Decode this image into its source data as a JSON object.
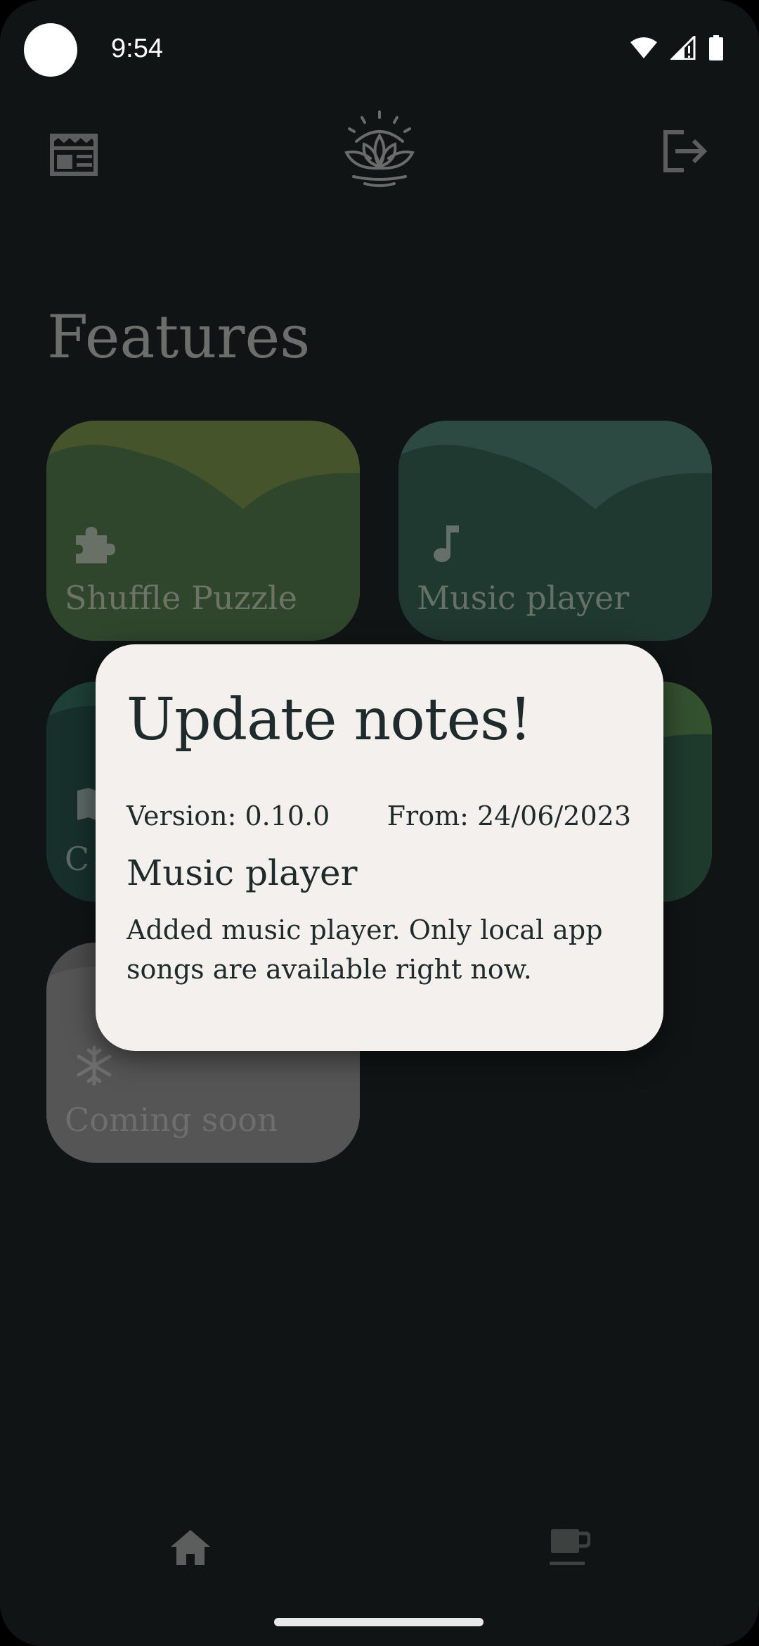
{
  "status_bar": {
    "time": "9:54"
  },
  "header": {
    "news_icon": "newspaper-icon",
    "logo_icon": "lotus-logo-icon",
    "logout_icon": "logout-icon"
  },
  "features": {
    "title": "Features",
    "cards": [
      {
        "label": "Shuffle Puzzle",
        "icon": "puzzle-icon"
      },
      {
        "label": "Music player",
        "icon": "music-note-icon"
      },
      {
        "label": "C",
        "icon": "map-icon"
      },
      {
        "label": "",
        "icon": ""
      },
      {
        "label": "Coming soon",
        "icon": "snowflake-icon"
      }
    ]
  },
  "dialog": {
    "title": "Update notes!",
    "version": "Version: 0.10.0",
    "date": "From: 24/06/2023",
    "subtitle": "Music player",
    "body": "Added music player. Only local app songs are available right now."
  },
  "bottom_nav": {
    "home_icon": "home-icon",
    "coffee_icon": "coffee-cup-icon"
  },
  "colors": {
    "background": "#101415",
    "dialog_bg": "#f4f0ed",
    "shuffle_card": "#2f462d",
    "music_card": "#1f3830",
    "soon_card": "#555555"
  }
}
